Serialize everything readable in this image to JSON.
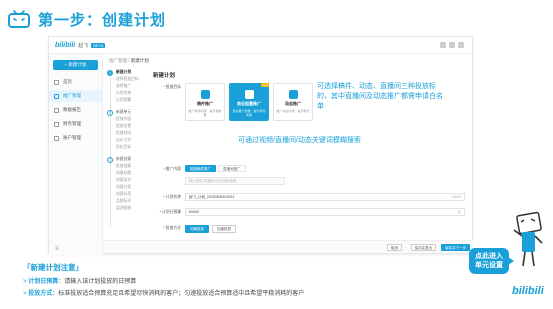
{
  "header": {
    "title": "第一步：创建计划",
    "icon": "tv-icon"
  },
  "app": {
    "logo": "bilibili",
    "logo_sub": "起飞",
    "logo_tag": "BETA",
    "breadcrumb_parent": "推广管理",
    "breadcrumb_sep": "/",
    "breadcrumb_current": "新建计划"
  },
  "sidebar": {
    "new_button": "+ 新建计划",
    "items": [
      {
        "label": "首页",
        "icon": "home-icon"
      },
      {
        "label": "推广管理",
        "icon": "megaphone-icon",
        "active": true
      },
      {
        "label": "数据报告",
        "icon": "chart-icon"
      },
      {
        "label": "财务管理",
        "icon": "wallet-icon"
      },
      {
        "label": "账户管理",
        "icon": "user-icon"
      }
    ],
    "collapse_icon": "≡"
  },
  "steps": [
    {
      "num": "1",
      "label": "新建计划",
      "active": true,
      "subs": [
        "选择投放目标",
        "选择推广",
        "计划名称",
        "计划预算"
      ]
    },
    {
      "num": "2",
      "label": "新建单元",
      "active": false,
      "subs": [
        "投放内容",
        "投放设置",
        "投放时间",
        "出价方式",
        "优化目标"
      ]
    },
    {
      "num": "3",
      "label": "新建创意",
      "active": false,
      "subs": [
        "投放创意",
        "创意标题",
        "创意形式",
        "创意分类",
        "创意标签",
        "品牌标识",
        "监测链接"
      ]
    }
  ],
  "form": {
    "title": "新建计划",
    "target_label": "* 投放目标",
    "cards": [
      {
        "name": "稿件推广",
        "desc": "推广稿件内容，提升播放量",
        "selected": false
      },
      {
        "name": "商业起量推广",
        "desc": "通过推广起量，提升转化效果",
        "selected": true,
        "tag": "new"
      },
      {
        "name": "动态推广",
        "desc": "推广动态内容，提升曝光",
        "selected": false
      }
    ],
    "content_label": "* 推广内容",
    "chips": [
      "投放稿件推广",
      "直播间推广"
    ],
    "search_placeholder": "输入稿件/直播间/动态链接搜索",
    "name_label": "* 计划名称",
    "name_value": "起飞_计划_20230506101033",
    "name_count": "23/40",
    "budget_label": "* 计划日预算",
    "budget_value": "50000",
    "budget_unit": "元",
    "mode_label": "* 投放方式",
    "modes": [
      "均衡投放",
      "加速投放"
    ],
    "bottom_buttons": [
      "取消",
      "保存并退出",
      "保存并下一步"
    ]
  },
  "callouts": {
    "c1": "可选择稿件、动态、直播间三种投放标的，其中直播间及动态推广都需申请白名单",
    "c2": "可通过视频/直播间/动态关键词模糊搜索"
  },
  "notes": {
    "title": "「新建计划注意」",
    "items": [
      {
        "key": "计划日预算",
        "text": "：请输入该计划投放的日预算"
      },
      {
        "key": "投放方式",
        "text": "：标准投放适合预算充足且希望尽快消耗的客户；匀速投放适合预算适中且希望平稳消耗的客户"
      }
    ]
  },
  "cta": {
    "line1": "点此进入",
    "line2": "单元设置"
  },
  "brand": "bilibili",
  "colors": {
    "accent": "#1aa0d8"
  }
}
